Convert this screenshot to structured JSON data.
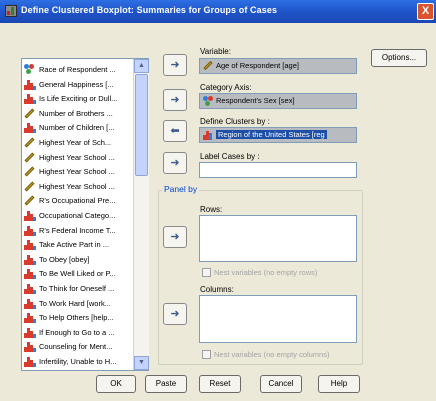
{
  "window": {
    "title": "Define Clustered Boxplot: Summaries for Groups of Cases",
    "close_glyph": "X"
  },
  "variable_list": {
    "items": [
      {
        "label": "Race of Respondent ...",
        "icon": "nominal-icon"
      },
      {
        "label": "General Happiness [...",
        "icon": "bar-icon"
      },
      {
        "label": "Is Life Exciting or Dull...",
        "icon": "bar-icon"
      },
      {
        "label": "Number of Brothers ...",
        "icon": "scale-icon"
      },
      {
        "label": "Number of Children [...",
        "icon": "bar-icon"
      },
      {
        "label": "Highest Year of Sch...",
        "icon": "scale-icon"
      },
      {
        "label": "Highest Year School ...",
        "icon": "scale-icon"
      },
      {
        "label": "Highest Year School ...",
        "icon": "scale-icon"
      },
      {
        "label": "Highest Year School ...",
        "icon": "scale-icon"
      },
      {
        "label": "R's Occupational Pre...",
        "icon": "scale-icon"
      },
      {
        "label": "Occupational Catego...",
        "icon": "bar-icon"
      },
      {
        "label": "R's Federal Income T...",
        "icon": "bar-icon"
      },
      {
        "label": "Take Active Part in ...",
        "icon": "bar-icon"
      },
      {
        "label": "To Obey [obey]",
        "icon": "bar-icon"
      },
      {
        "label": "To Be Well Liked or P...",
        "icon": "bar-icon"
      },
      {
        "label": "To Think for Oneself ...",
        "icon": "bar-icon"
      },
      {
        "label": "To Work Hard [work...",
        "icon": "bar-icon"
      },
      {
        "label": "To Help Others [help...",
        "icon": "bar-icon"
      },
      {
        "label": "If Enough to Go to a ...",
        "icon": "bar-icon"
      },
      {
        "label": "Counseling for Ment...",
        "icon": "bar-icon"
      },
      {
        "label": "Infertility, Unable to H...",
        "icon": "bar-icon"
      }
    ],
    "scroll_up_glyph": "▲",
    "scroll_down_glyph": "▼"
  },
  "fields": {
    "variable": {
      "label": "Variable:",
      "value": "Age of Respondent [age]",
      "icon": "scale-icon"
    },
    "category_axis": {
      "label": "Category Axis:",
      "value": "Respondent's Sex [sex]",
      "icon": "nominal-icon"
    },
    "define_clusters": {
      "label": "Define Clusters by :",
      "value": "Region of the United States [reg",
      "icon": "bar-icon"
    },
    "label_cases": {
      "label": "Label Cases by :",
      "value": ""
    }
  },
  "panel": {
    "title": "Panel by",
    "rows_label": "Rows:",
    "rows_nest": "Nest variables (no empty rows)",
    "columns_label": "Columns:",
    "columns_nest": "Nest variables (no empty columns)"
  },
  "buttons": {
    "options": "Options...",
    "ok": "OK",
    "paste": "Paste",
    "reset": "Reset",
    "cancel": "Cancel",
    "help": "Help"
  },
  "arrows": {
    "right": "➜",
    "left": "⬅"
  },
  "colors": {
    "titlebar": "#1E53C8",
    "dialog_bg": "#ECE9D8",
    "panel_title": "#0046D5",
    "selection": "#1E4FA8"
  }
}
